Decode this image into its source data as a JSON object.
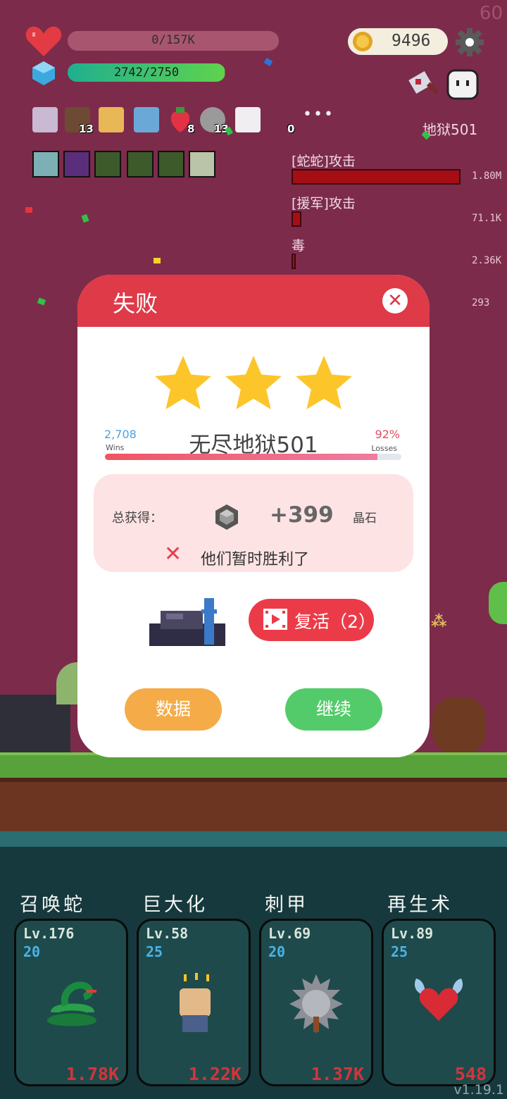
{
  "hud": {
    "fps": "60",
    "hp_text": "0/157K",
    "mana_text": "2742/2750",
    "mana_fraction": 0.996,
    "coins": "9496",
    "stage_label": "地狱501",
    "item_counts": [
      "13",
      "8",
      "13",
      "0"
    ]
  },
  "damage": [
    {
      "label": "[蛇蛇]攻击",
      "value": "1.80M"
    },
    {
      "label": "[援军]攻击",
      "value": "71.1K"
    },
    {
      "label": "毒",
      "value": "2.36K"
    },
    {
      "label": "",
      "value": "293"
    }
  ],
  "modal": {
    "title": "失败",
    "close_icon": "close-icon",
    "stars": 3,
    "stage_name": "无尽地狱501",
    "wins_count": "2,708",
    "wins_label": "Wins",
    "loss_percent": "92%",
    "loss_label": "Losses",
    "progress_fraction": 0.92,
    "reward_label": "总获得：",
    "reward_amount": "+399",
    "reward_unit": "晶石",
    "result_message": "他们暂时胜利了",
    "revive_label": "复活（2）",
    "data_button": "数据",
    "continue_button": "继续"
  },
  "skills": [
    {
      "name": "召唤蛇",
      "level": "Lv.176",
      "cost": "20",
      "value": "1.78K",
      "icon": "snake-icon"
    },
    {
      "name": "巨大化",
      "level": "Lv.58",
      "cost": "25",
      "value": "1.22K",
      "icon": "fist-icon"
    },
    {
      "name": "刺甲",
      "level": "Lv.69",
      "cost": "20",
      "value": "1.37K",
      "icon": "spiked-mace-icon"
    },
    {
      "name": "再生术",
      "level": "Lv.89",
      "cost": "25",
      "value": "548",
      "icon": "winged-heart-icon"
    }
  ],
  "version": "v1.19.1",
  "colors": {
    "primary_red": "#df3a48",
    "continue_green": "#54cb6a",
    "data_orange": "#f5ac48",
    "star": "#fcc52a"
  }
}
